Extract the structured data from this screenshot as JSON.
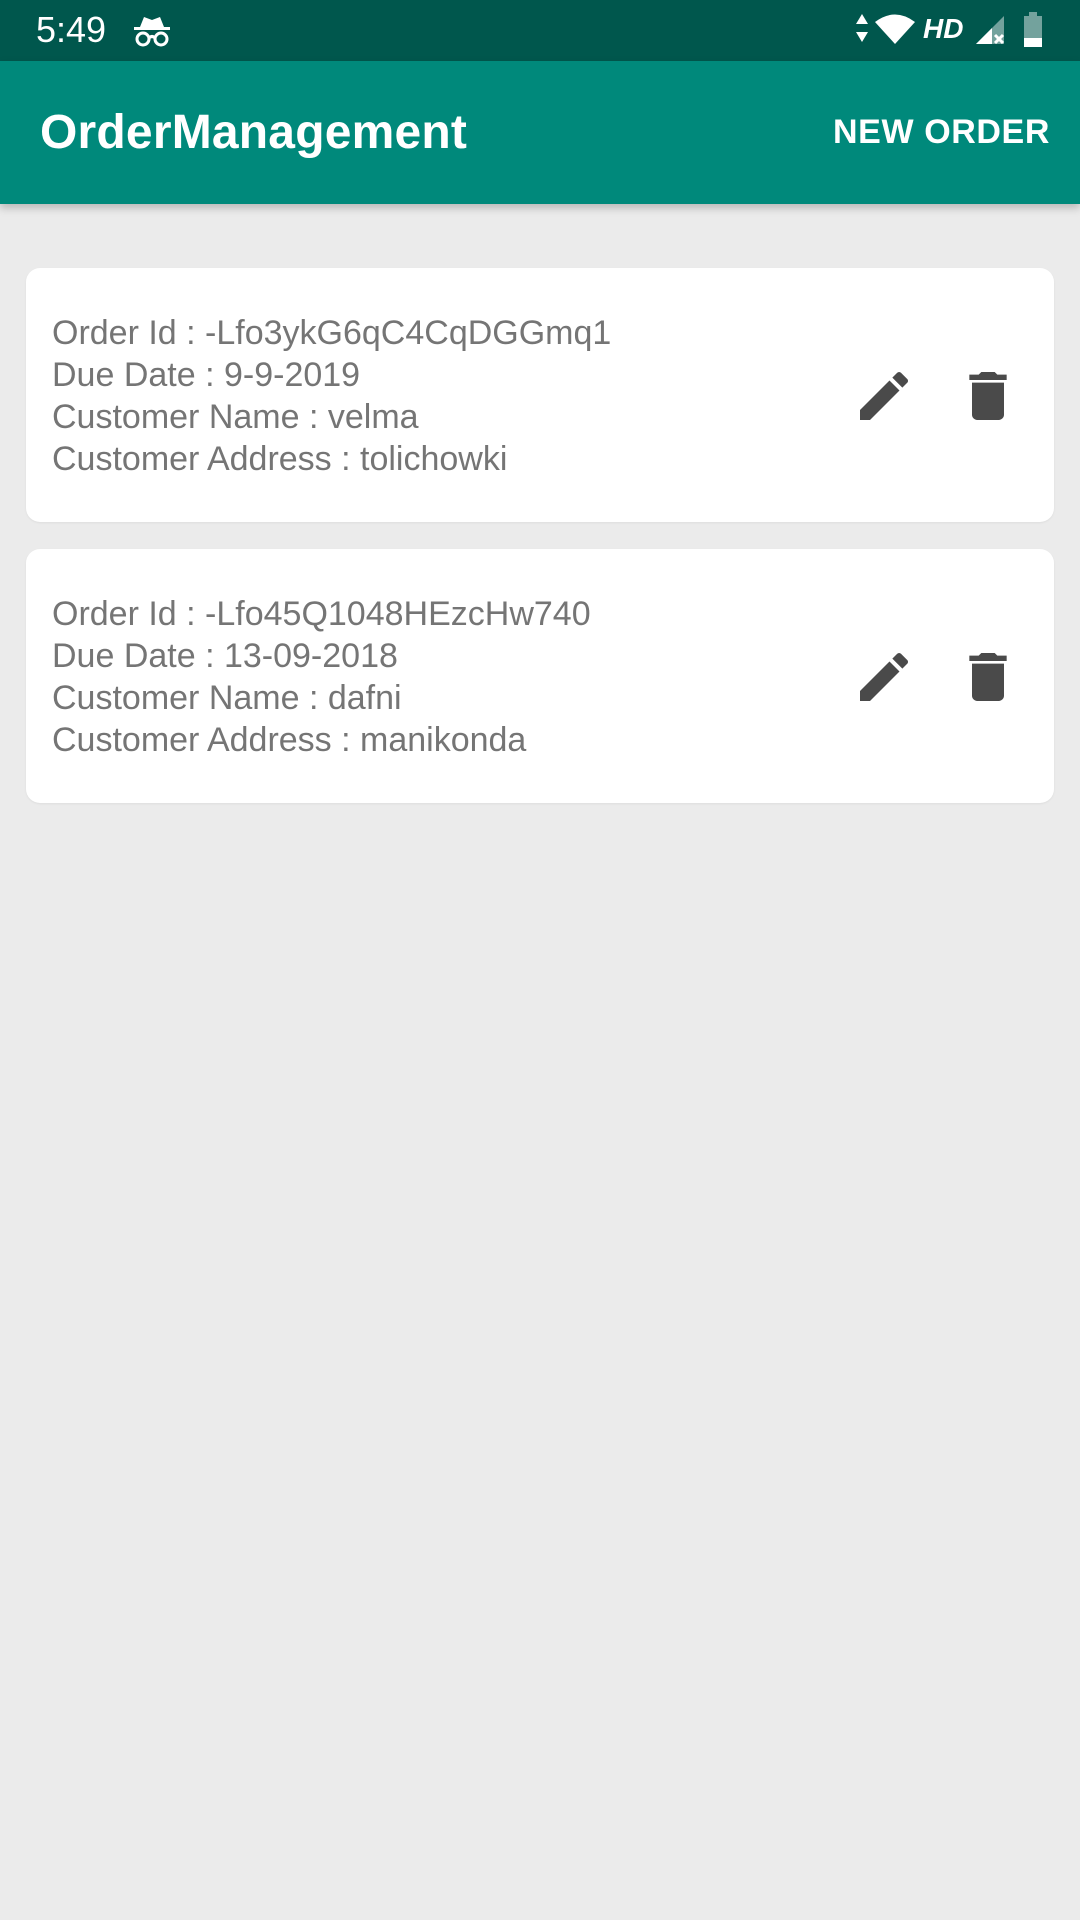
{
  "status_bar": {
    "time": "5:49",
    "network_label": "HD",
    "icons": [
      "incognito-icon",
      "data-arrows-icon",
      "wifi-icon",
      "signal-icon",
      "battery-icon"
    ]
  },
  "app_bar": {
    "title": "OrderManagement",
    "action_label": "NEW ORDER"
  },
  "colors": {
    "status_bar": "#00574d",
    "app_bar": "#00897b",
    "background": "#ebebeb",
    "card": "#ffffff",
    "text": "#757575",
    "icon": "#4a4a4a"
  },
  "orders": [
    {
      "order_id": "Order Id : -Lfo3ykG6qC4CqDGGmq1",
      "due_date": "Due Date : 9-9-2019",
      "customer_name": "Customer Name : velma",
      "customer_address": "Customer Address : tolichowki",
      "edit_icon": "pencil-icon",
      "delete_icon": "trash-icon"
    },
    {
      "order_id": "Order Id : -Lfo45Q1048HEzcHw740",
      "due_date": "Due Date : 13-09-2018",
      "customer_name": "Customer Name : dafni",
      "customer_address": "Customer Address : manikonda",
      "edit_icon": "pencil-icon",
      "delete_icon": "trash-icon"
    }
  ]
}
